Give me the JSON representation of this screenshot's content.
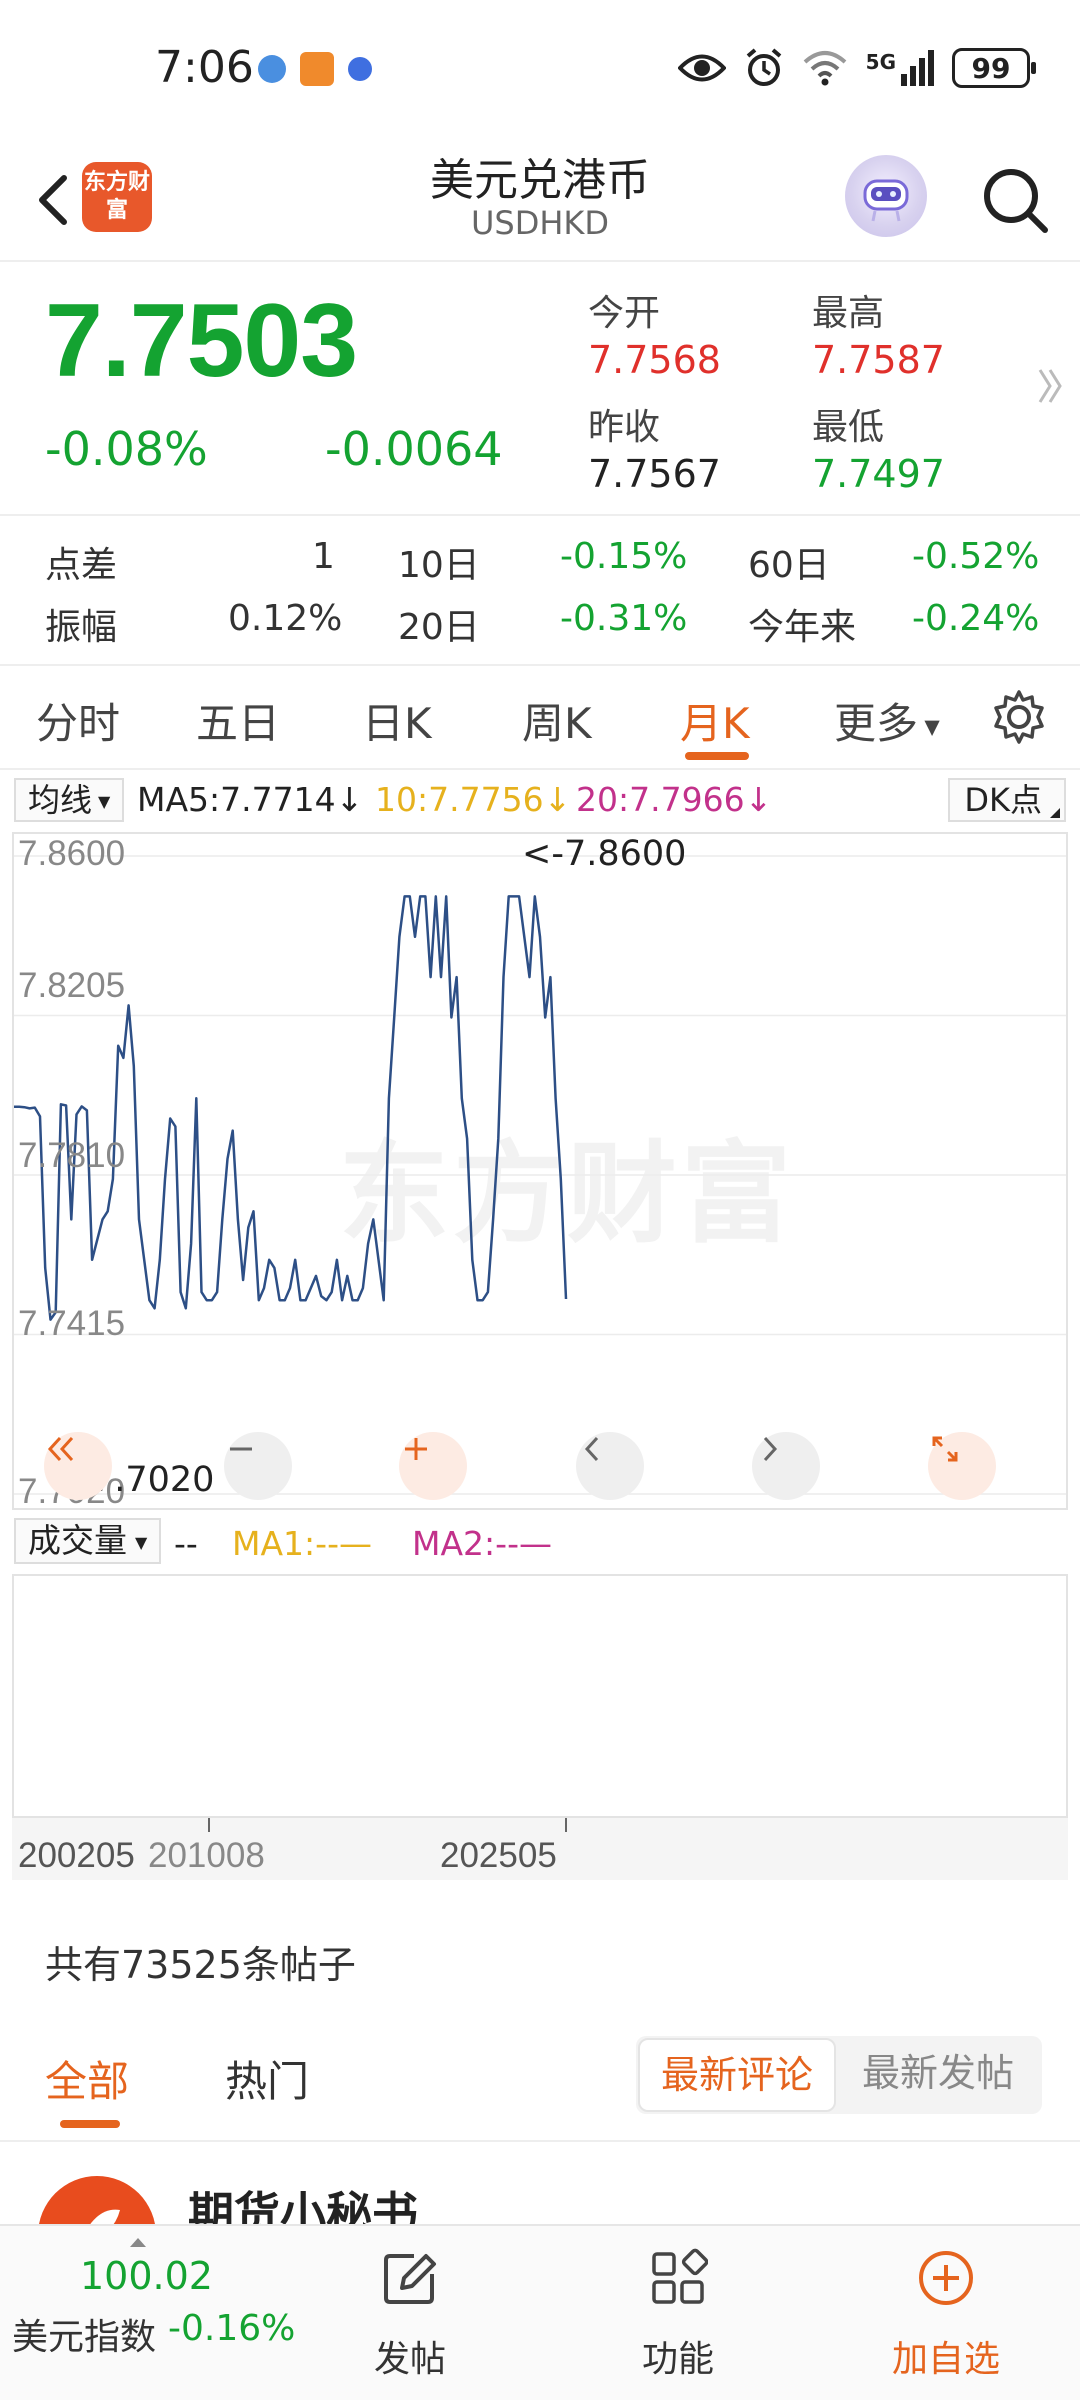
{
  "status_bar": {
    "time": "7:06",
    "network": "5G",
    "battery": "99"
  },
  "header": {
    "title": "美元兑港币",
    "code": "USDHKD",
    "brand": "东方财富"
  },
  "quote": {
    "price": "7.7503",
    "change_pct": "-0.08%",
    "change_abs": "-0.0064",
    "open_label": "今开",
    "open": "7.7568",
    "high_label": "最高",
    "high": "7.7587",
    "prev_close_label": "昨收",
    "prev_close": "7.7567",
    "low_label": "最低",
    "low": "7.7497"
  },
  "stats": {
    "spread_label": "点差",
    "spread": "1",
    "amp_label": "振幅",
    "amp": "0.12%",
    "d10_label": "10日",
    "d10": "-0.15%",
    "d20_label": "20日",
    "d20": "-0.31%",
    "d60_label": "60日",
    "d60": "-0.52%",
    "ytd_label": "今年来",
    "ytd": "-0.24%"
  },
  "tabs": [
    {
      "label": "分时"
    },
    {
      "label": "五日"
    },
    {
      "label": "日K"
    },
    {
      "label": "周K"
    },
    {
      "label": "月K"
    },
    {
      "label": "更多"
    }
  ],
  "ma_legend": {
    "selector": "均线",
    "ma5": "MA5:7.7714↓",
    "ma10": "10:7.7756↓",
    "ma20": "20:7.7966↓",
    "dk": "DK点"
  },
  "chart": {
    "watermark": "东方财富",
    "max_annotation": "<-7.8600",
    "min_annotation": "<-7.7020",
    "y_ticks": [
      "7.8600",
      "7.8205",
      "7.7810",
      "7.7415",
      "7.7020"
    ],
    "x_labels": [
      "200205",
      "201008",
      "202505"
    ]
  },
  "chart_data": {
    "type": "line",
    "x": [
      "200205",
      "201008",
      "202505"
    ],
    "ylim": [
      7.702,
      7.86
    ],
    "y_ticks": [
      7.86,
      7.8205,
      7.781,
      7.7415,
      7.702
    ],
    "series": [
      {
        "values": [
          7.7979,
          7.7979,
          7.7978,
          7.7975,
          7.7977,
          7.7955,
          7.758,
          7.7452,
          7.747,
          7.7985,
          7.7982,
          7.77,
          7.796,
          7.798,
          7.797,
          7.76,
          7.765,
          7.77,
          7.772,
          7.78,
          7.813,
          7.81,
          7.823,
          7.808,
          7.77,
          7.76,
          7.75,
          7.748,
          7.76,
          7.78,
          7.795,
          7.793,
          7.752,
          7.748,
          7.764,
          7.8,
          7.752,
          7.75,
          7.75,
          7.752,
          7.77,
          7.785,
          7.792,
          7.77,
          7.755,
          7.768,
          7.772,
          7.75,
          7.753,
          7.76,
          7.758,
          7.75,
          7.75,
          7.753,
          7.76,
          7.75,
          7.75,
          7.753,
          7.756,
          7.751,
          7.75,
          7.752,
          7.76,
          7.75,
          7.756,
          7.75,
          7.75,
          7.753,
          7.764,
          7.77,
          7.76,
          7.75,
          7.8,
          7.82,
          7.84,
          7.85,
          7.85,
          7.84,
          7.85,
          7.85,
          7.83,
          7.85,
          7.83,
          7.85,
          7.82,
          7.83,
          7.8,
          7.79,
          7.76,
          7.75,
          7.75,
          7.752,
          7.77,
          7.79,
          7.83,
          7.85,
          7.85,
          7.85,
          7.84,
          7.83,
          7.85,
          7.84,
          7.82,
          7.83,
          7.8,
          7.78,
          7.7503
        ]
      }
    ],
    "grid": true
  },
  "volume": {
    "selector": "成交量",
    "value": "--",
    "ma1": "MA1:--—",
    "ma2": "MA2:--—"
  },
  "posts": {
    "count_text": "共有73525条帖子",
    "tab_all": "全部",
    "tab_hot": "热门",
    "sort_latest_comment": "最新评论",
    "sort_latest_post": "最新发帖",
    "first_author": "期货小秘书"
  },
  "bottom_nav": {
    "index_value": "100.02",
    "index_name": "美元指数",
    "index_pct": "-0.16%",
    "post": "发帖",
    "functions": "功能",
    "add_watchlist": "加自选"
  }
}
